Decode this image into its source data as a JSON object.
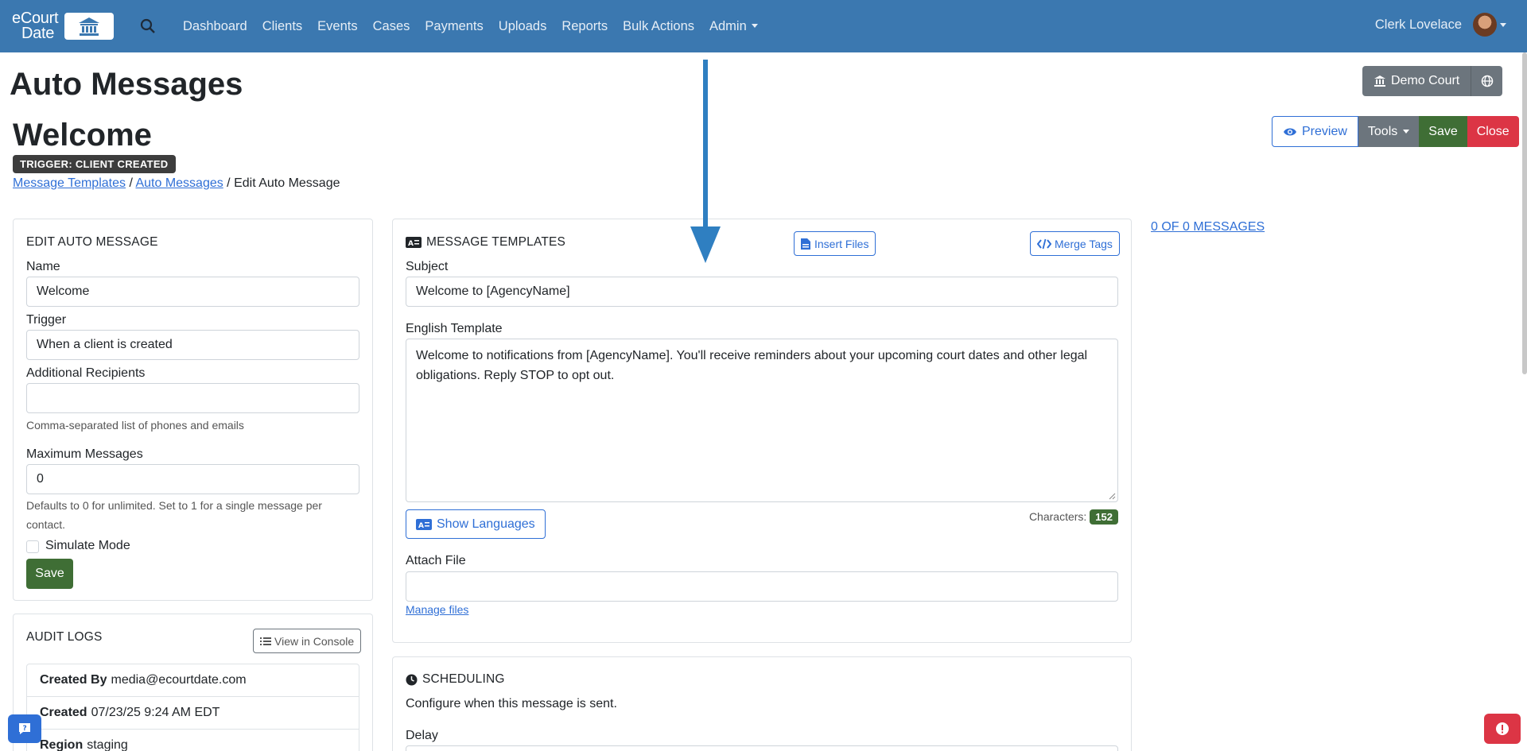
{
  "navbar": {
    "logo_line1": "eCourt",
    "logo_line2": "Date",
    "links": [
      "Dashboard",
      "Clients",
      "Events",
      "Cases",
      "Payments",
      "Uploads",
      "Reports",
      "Bulk Actions"
    ],
    "admin_label": "Admin",
    "user_name": "Clerk Lovelace"
  },
  "header": {
    "page_title": "Auto Messages",
    "record_title": "Welcome",
    "trigger_badge": "TRIGGER: CLIENT CREATED",
    "breadcrumb": {
      "link1": "Message Templates",
      "sep1": " / ",
      "link2": "Auto Messages",
      "sep2": " / ",
      "current": "Edit Auto Message"
    },
    "agency_button": "Demo Court",
    "actions": {
      "preview": "Preview",
      "tools": "Tools",
      "save": "Save",
      "close": "Close"
    }
  },
  "edit_card": {
    "heading": "EDIT AUTO MESSAGE",
    "name_label": "Name",
    "name_value": "Welcome",
    "trigger_label": "Trigger",
    "trigger_value": "When a client is created",
    "recipients_label": "Additional Recipients",
    "recipients_value": "",
    "recipients_help": "Comma-separated list of phones and emails",
    "max_label": "Maximum Messages",
    "max_value": "0",
    "max_help_line1": "Defaults to 0 for unlimited. Set to 1 for a single message per",
    "max_help_line2": "contact.",
    "simulate_label": "Simulate Mode",
    "save_label": "Save"
  },
  "audit_card": {
    "heading": "AUDIT LOGS",
    "console_button": "View in Console",
    "rows": [
      {
        "key": "Created By",
        "value": "media@ecourtdate.com"
      },
      {
        "key": "Created",
        "value": "07/23/25 9:24 AM EDT"
      },
      {
        "key": "Region",
        "value": "staging"
      }
    ]
  },
  "templates_card": {
    "heading": "MESSAGE TEMPLATES",
    "insert_files": "Insert Files",
    "merge_tags": "Merge Tags",
    "subject_label": "Subject",
    "subject_value": "Welcome to [AgencyName]",
    "english_label": "English Template",
    "english_line1": "Welcome to notifications from [AgencyName]. You'll receive reminders about your upcoming court dates and other legal",
    "english_line2": "obligations. Reply STOP to opt out.",
    "show_languages": "Show Languages",
    "characters_label": "Characters:",
    "characters_count": "152",
    "attach_label": "Attach File",
    "manage_files": "Manage files"
  },
  "scheduling_card": {
    "heading": "SCHEDULING",
    "description": "Configure when this message is sent.",
    "delay_label": "Delay"
  },
  "messages_link": "0 OF 0 MESSAGES",
  "icons": {
    "arrow_color": "#2f7fc1"
  }
}
